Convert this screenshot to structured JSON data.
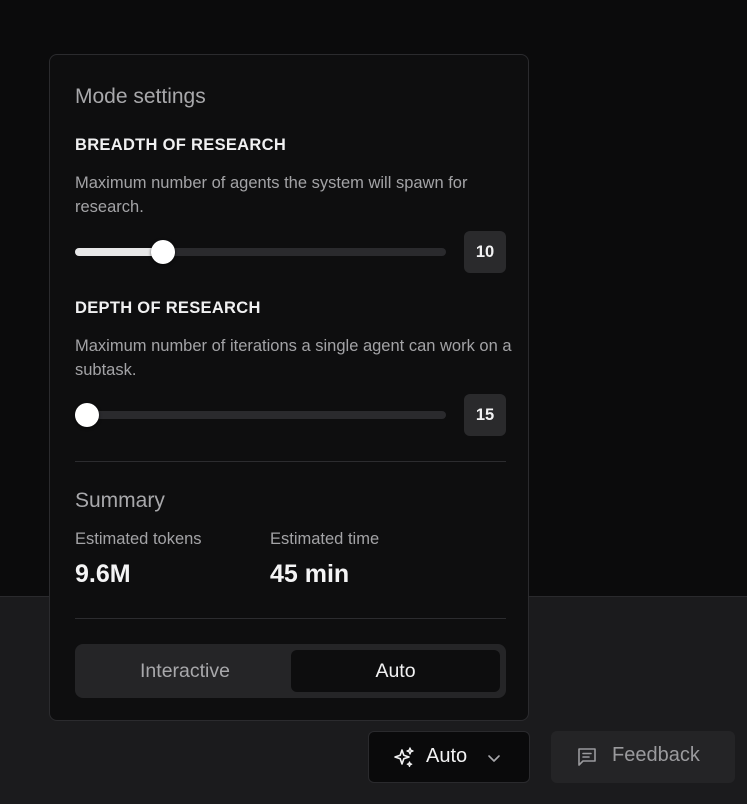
{
  "panel": {
    "title": "Mode settings",
    "breadth": {
      "heading": "BREADTH OF RESEARCH",
      "description": "Maximum number of agents the system will spawn for research.",
      "value": "10",
      "fill_fraction": 0.22
    },
    "depth": {
      "heading": "DEPTH OF RESEARCH",
      "description": "Maximum number of iterations a single agent can work on a subtask.",
      "value": "15",
      "fill_fraction": 0.0
    },
    "summary": {
      "title": "Summary",
      "tokens_label": "Estimated tokens",
      "tokens_value": "9.6M",
      "time_label": "Estimated time",
      "time_value": "45 min"
    },
    "mode_toggle": {
      "options": [
        "Interactive",
        "Auto"
      ],
      "selected": "Auto"
    }
  },
  "footer": {
    "mode_button_label": "Auto",
    "feedback_label": "Feedback"
  },
  "icons": {
    "mode_button_icon": "sparkle-icon",
    "mode_button_chevron": "chevron-down-icon",
    "feedback_icon": "message-square-icon"
  },
  "colors": {
    "background": "#0b0b0c",
    "panel": "#0e0e0f",
    "bottom_bar": "#1b1b1d",
    "text_primary": "#f2f2f3",
    "text_muted": "#a3a3a6"
  }
}
